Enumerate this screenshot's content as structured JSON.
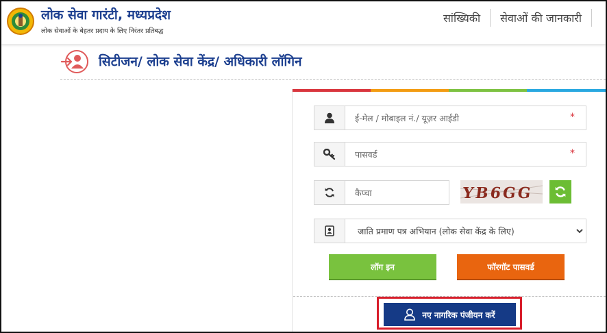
{
  "header": {
    "title": "लोक सेवा गारंटी, मध्यप्रदेश",
    "subtitle": "लोक सेवाओं के बेहतर प्रदाय के लिए निरंतर प्रतिबद्ध",
    "nav": [
      {
        "label": "सांख्यिकी"
      },
      {
        "label": "सेवाओं की जानकारी"
      }
    ]
  },
  "login": {
    "heading": "सिटीजन/ लोक सेवा केंद्र/ अधिकारी लॉगिन"
  },
  "form": {
    "username": {
      "placeholder": "ई-मेल / मोबाइल नं./ यूज़र आईडी",
      "value": "",
      "required_mark": "*",
      "icon": "user-icon"
    },
    "password": {
      "placeholder": "पासवर्ड",
      "value": "",
      "required_mark": "*",
      "icon": "key-icon"
    },
    "captcha": {
      "placeholder": "कैप्चा",
      "value": "",
      "icon": "refresh-icon",
      "image_text": "YB6GG"
    },
    "campaign_select": {
      "selected": "जाति प्रमाण पत्र अभियान (लोक सेवा केंद्र के लिए)",
      "icon": "contact-book-icon"
    },
    "login_button": "लॉग इन",
    "forgot_button": "फॉरगॉट पासवर्ड",
    "register_button": "नए नागरिक पंजीयन करें"
  },
  "colors": {
    "brand_blue": "#1c3f8f",
    "login_green": "#79c23e",
    "forgot_orange": "#e9650f",
    "register_navy": "#153a86",
    "highlight_red": "#d81e2b"
  }
}
